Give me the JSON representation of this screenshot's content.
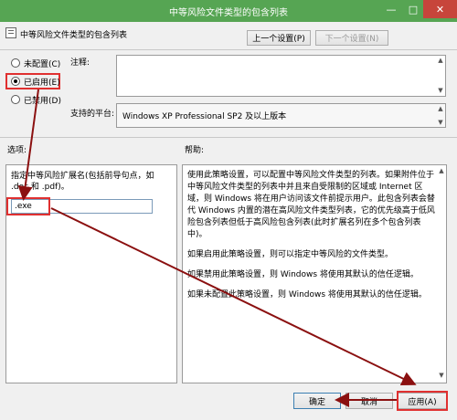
{
  "window": {
    "title": "中等风险文件类型的包含列表",
    "minimize": "—",
    "maximize": "□",
    "close": "✕"
  },
  "header": {
    "heading": "中等风险文件类型的包含列表",
    "prev_setting": "上一个设置(P)",
    "next_setting": "下一个设置(N)"
  },
  "state": {
    "options": [
      "未配置(C)",
      "已启用(E)",
      "已禁用(D)"
    ],
    "selected_index": 1
  },
  "comment": {
    "label": "注释:",
    "value": ""
  },
  "supported": {
    "label": "支持的平台:",
    "value": "Windows XP Professional SP2 及以上版本"
  },
  "options_panel": {
    "label": "选项:",
    "extension_label": "指定中等风险扩展名(包括前导句点，如 .doc 和 .pdf)。",
    "extension_value": ".exe"
  },
  "help": {
    "label": "帮助:",
    "paragraphs": [
      "使用此策略设置，可以配置中等风险文件类型的列表。如果附件位于中等风险文件类型的列表中并且来自受限制的区域或 Internet 区域，则 Windows 将在用户访问该文件前提示用户。此包含列表会替代 Windows 内置的潜在高风险文件类型列表，它的优先级高于低风险包含列表但低于高风险包含列表(此时扩展名列在多个包含列表中)。",
      "如果启用此策略设置，则可以指定中等风险的文件类型。",
      "如果禁用此策略设置，则 Windows 将使用其默认的信任逻辑。",
      "如果未配置此策略设置，则 Windows 将使用其默认的信任逻辑。"
    ]
  },
  "footer": {
    "ok": "确定",
    "cancel": "取消",
    "apply": "应用(A)"
  },
  "colors": {
    "titlebar": "#56a553",
    "close": "#c7453b",
    "highlight": "#e03030",
    "arrow": "#8b1010"
  }
}
